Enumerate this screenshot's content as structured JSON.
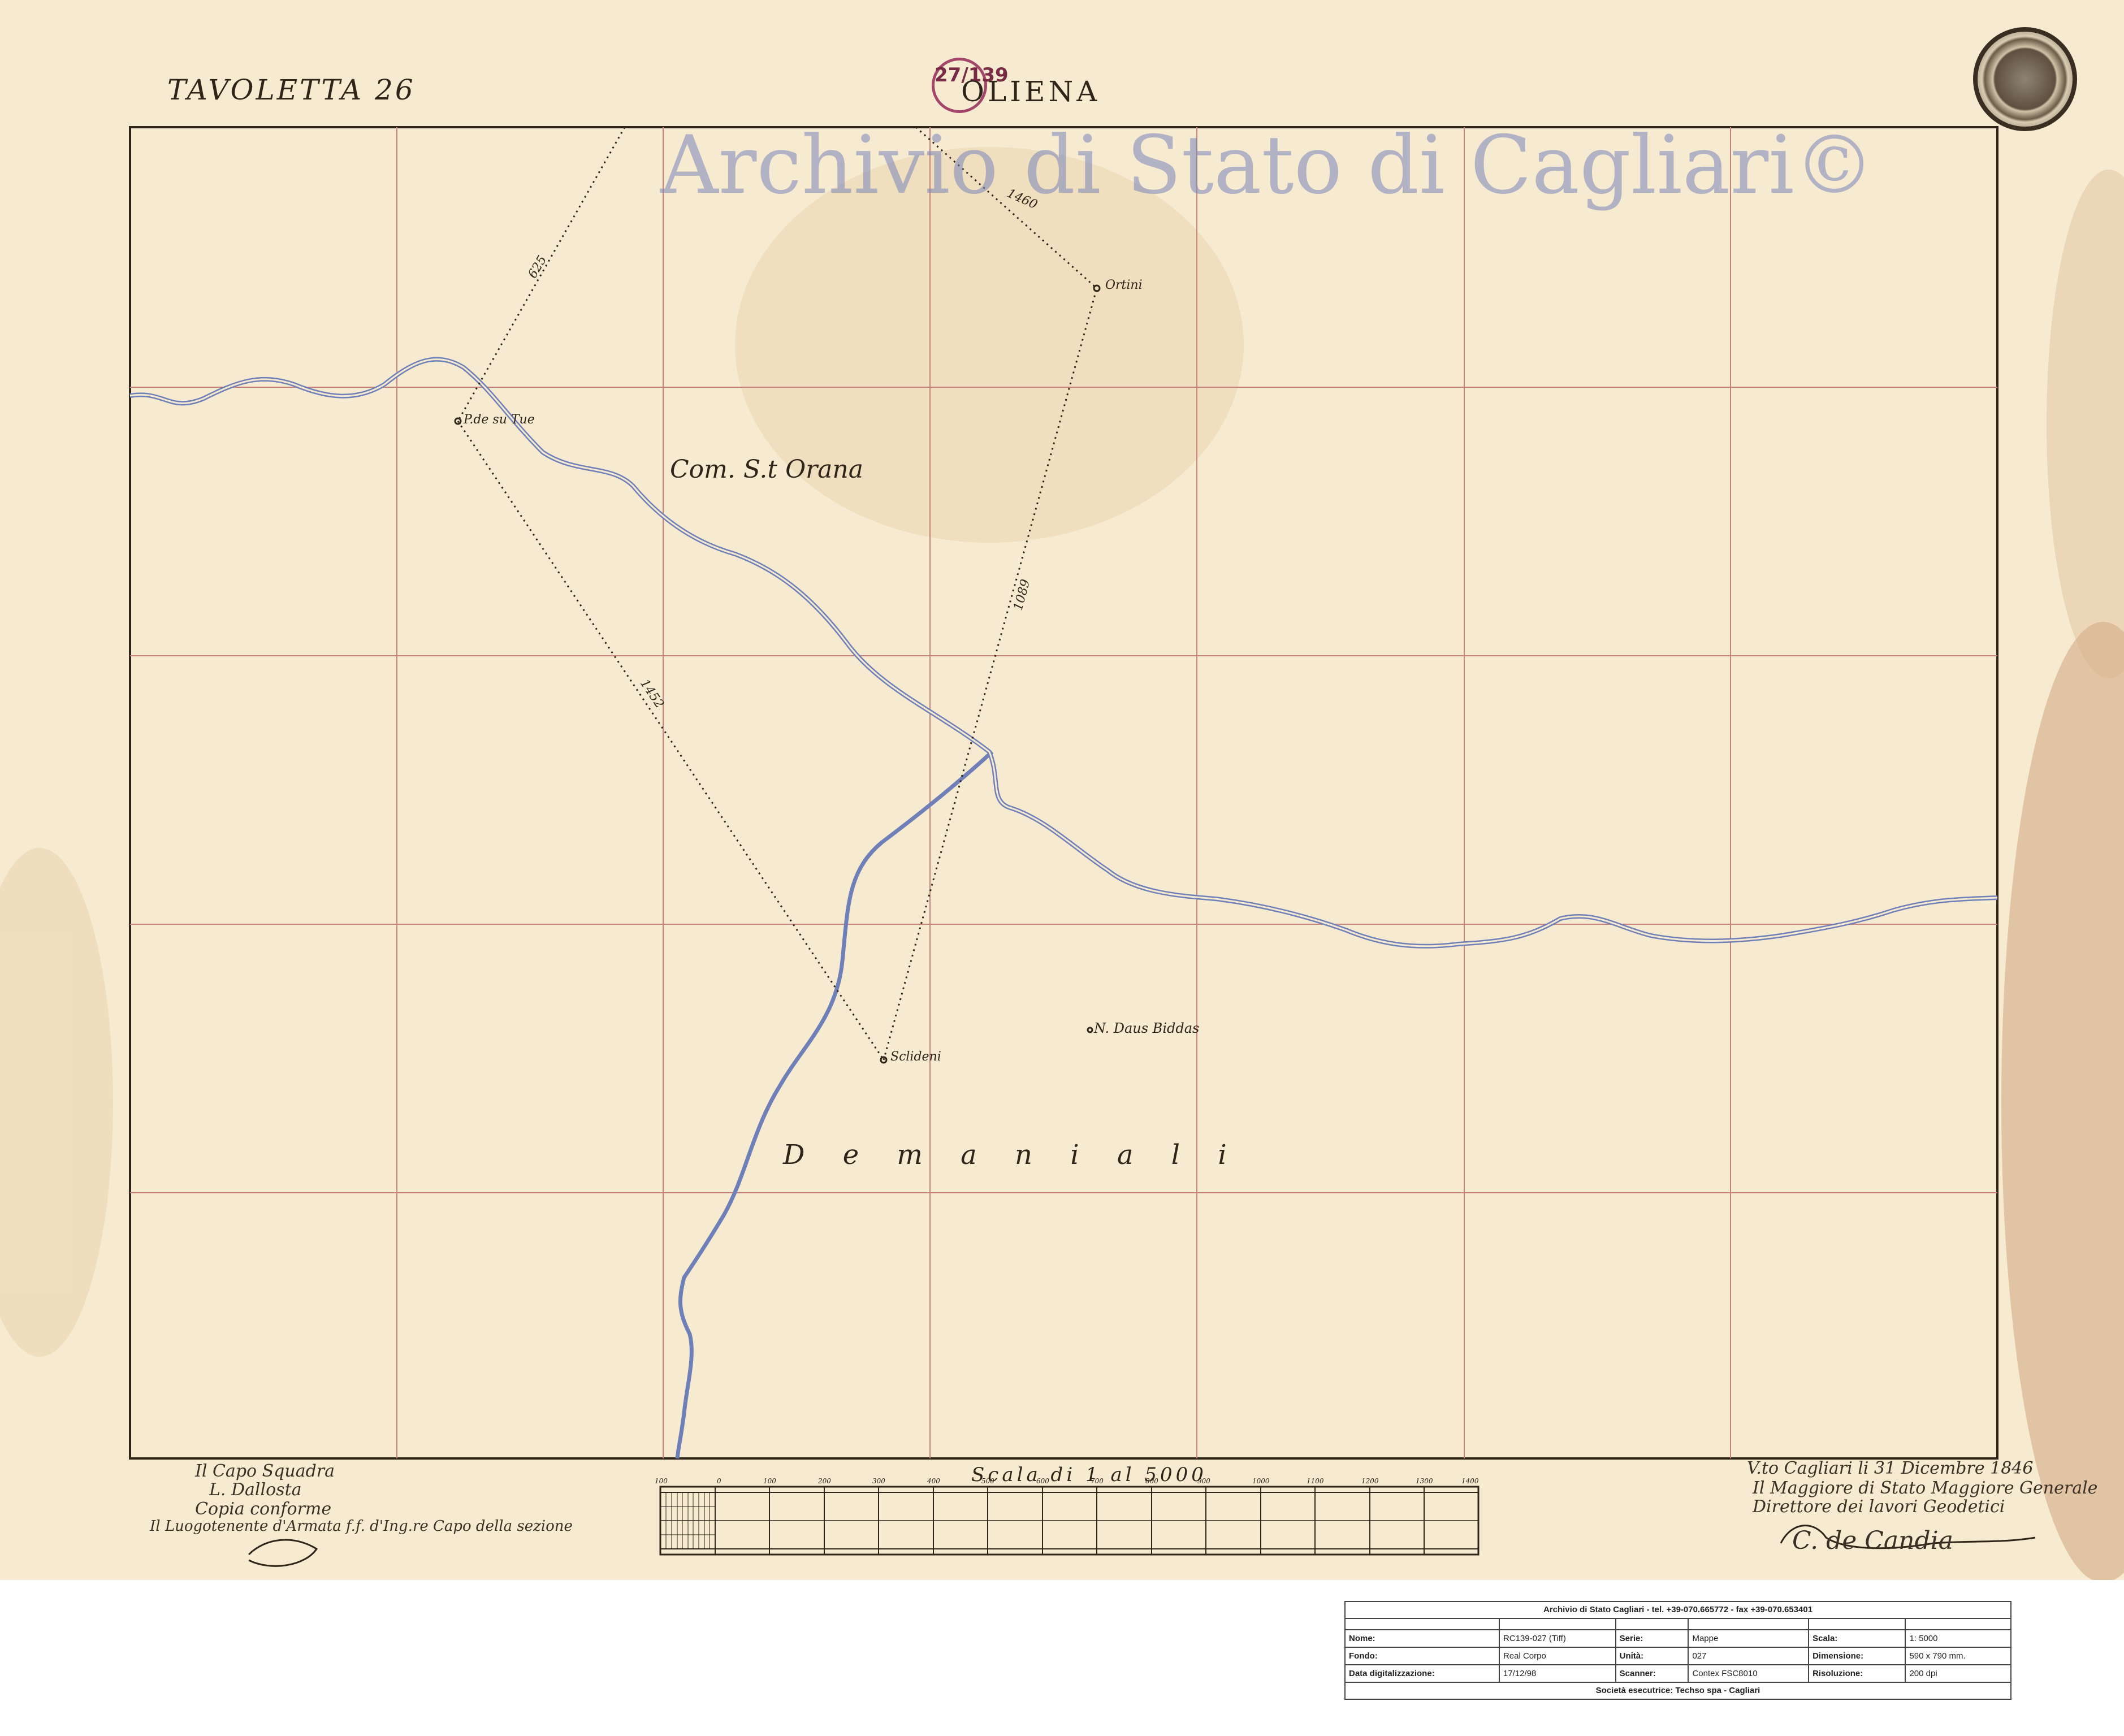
{
  "sheet": {
    "sheet_label": "TAVOLETTA 26",
    "town_name": "OLIENA",
    "catalogue_stamp": "27/139",
    "watermark": "Archivio di Stato di Cagliari©"
  },
  "map": {
    "station_labels": [
      "Ortini",
      "P.de su Tue",
      "Sclideni"
    ],
    "place_labels": [
      "Com. S.t Orana",
      "N. Daus Biddas"
    ],
    "region_label": "D e m a n i a l i",
    "line_lengths": [
      "1460",
      "625",
      "1089",
      "1452"
    ],
    "colors": {
      "paper": "#f6ead0",
      "grid": "#c9827a",
      "river": "#6f7fb8",
      "ink": "#2e2418",
      "watermark": "#7884b9"
    }
  },
  "scale_bar": {
    "title": "Scala di 1 al 5000",
    "ticks": [
      "100",
      "0",
      "100",
      "200",
      "300",
      "400",
      "500",
      "600",
      "700",
      "800",
      "900",
      "1000",
      "1100",
      "1200",
      "1300",
      "1400"
    ]
  },
  "signatures": {
    "left": [
      "Il Capo Squadra",
      "L. Dallosta",
      "Copia conforme",
      "Il Luogotenente d'Armata f.f. d'Ing.re Capo della sezione"
    ],
    "right": [
      "V.to Cagliari li 31 Dicembre 1846",
      "Il Maggiore di Stato Maggiore Generale",
      "Direttore dei lavori Geodetici"
    ],
    "right_signature": "C. de Candia"
  },
  "info_panel": {
    "header": "Archivio di Stato Cagliari - tel. +39-070.665772 - fax +39-070.653401",
    "rows": [
      {
        "k1": "Nome:",
        "v1": "RC139-027 (Tiff)",
        "k2": "Serie:",
        "v2": "Mappe",
        "k3": "Scala:",
        "v3": "1: 5000"
      },
      {
        "k1": "Fondo:",
        "v1": "Real Corpo",
        "k2": "Unità:",
        "v2": "027",
        "k3": "Dimensione:",
        "v3": "590 x 790 mm."
      },
      {
        "k1": "Data digitalizzazione:",
        "v1": "17/12/98",
        "k2": "Scanner:",
        "v2": "Contex FSC8010",
        "k3": "Risoluzione:",
        "v3": "200 dpi"
      }
    ],
    "footer": "Società esecutrice: Techso spa - Cagliari"
  }
}
